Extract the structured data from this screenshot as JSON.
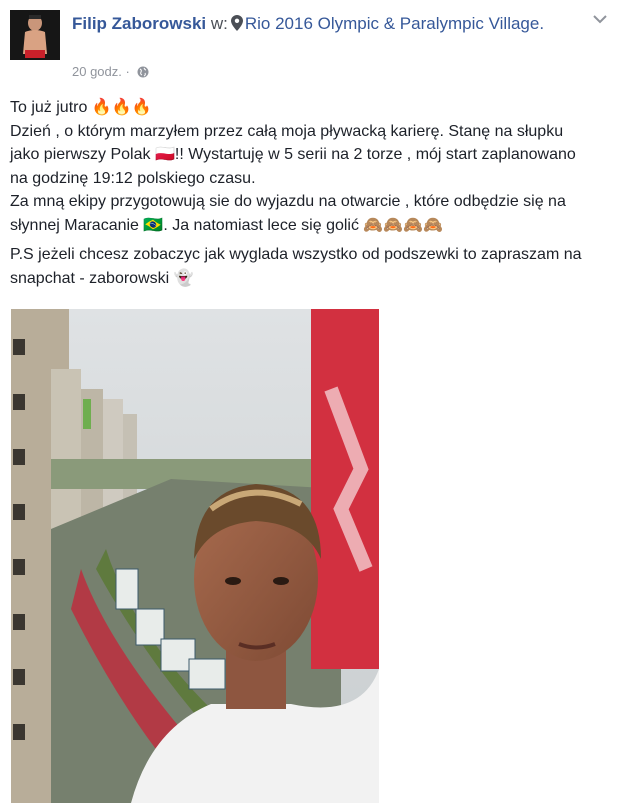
{
  "post": {
    "author": "Filip Zaborowski",
    "with_word": "w:",
    "location": "Rio 2016 Olympic & Paralympic Village.",
    "timestamp": "20 godz.",
    "separator": "·"
  },
  "body": {
    "line1": "To już jutro 🔥🔥🔥",
    "line2": "Dzień , o którym marzyłem przez całą moja pływacką karierę. Stanę na słupku jako pierwszy Polak 🇵🇱!! Wystartuję w 5 serii na 2 torze , mój start zaplanowano na godzinę 19:12 polskiego czasu.",
    "line3": "Za mną ekipy przygotowują sie do wyjazdu na otwarcie , które odbędzie się na słynnej Maracanie 🇧🇷. Ja natomiast lece się golić 🙈🙈🙈🙈",
    "line4": "P.S jeżeli chcesz zobaczyc jak wyglada wszystko od podszewki to zapraszam na snapchat - zaborowski 👻"
  },
  "icons": {
    "pin": "map-pin-icon",
    "globe": "globe-icon",
    "chevron": "chevron-down-icon"
  },
  "colors": {
    "link": "#365899",
    "meta": "#90949c",
    "text": "#1d2129"
  }
}
